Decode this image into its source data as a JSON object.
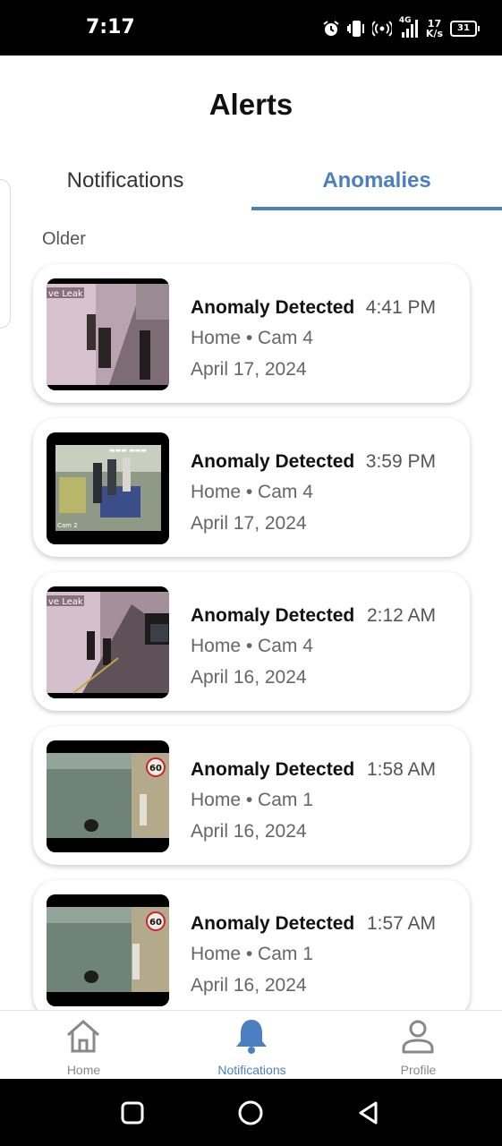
{
  "status_bar": {
    "time": "7:17",
    "net_speed_value": "17",
    "net_speed_unit": "K/s",
    "network_type": "4G",
    "battery": "31"
  },
  "header": {
    "title": "Alerts"
  },
  "tabs": [
    {
      "label": "Notifications",
      "active": false
    },
    {
      "label": "Anomalies",
      "active": true
    }
  ],
  "section_label": "Older",
  "alerts": [
    {
      "title": "Anomaly Detected",
      "time": "4:41 PM",
      "location": "Home • Cam 4",
      "date": "April 17, 2024",
      "thumbnail_text": "ve Leak"
    },
    {
      "title": "Anomaly Detected",
      "time": "3:59 PM",
      "location": "Home • Cam 4",
      "date": "April 17, 2024",
      "thumbnail_text": "Cam 2"
    },
    {
      "title": "Anomaly Detected",
      "time": "2:12 AM",
      "location": "Home • Cam 4",
      "date": "April 16, 2024",
      "thumbnail_text": "ve Leak"
    },
    {
      "title": "Anomaly Detected",
      "time": "1:58 AM",
      "location": "Home • Cam 1",
      "date": "April 16, 2024",
      "thumbnail_text": "60"
    },
    {
      "title": "Anomaly Detected",
      "time": "1:57 AM",
      "location": "Home • Cam 1",
      "date": "April 16, 2024",
      "thumbnail_text": "60"
    }
  ],
  "bottom_nav": {
    "items": [
      {
        "label": "Home",
        "icon": "home-icon",
        "active": false
      },
      {
        "label": "Notifications",
        "icon": "bell-icon",
        "active": true
      },
      {
        "label": "Profile",
        "icon": "person-icon",
        "active": false
      }
    ]
  },
  "colors": {
    "accent": "#4a7fc1",
    "inactive": "#888888",
    "status_bar_bg": "#000000"
  }
}
